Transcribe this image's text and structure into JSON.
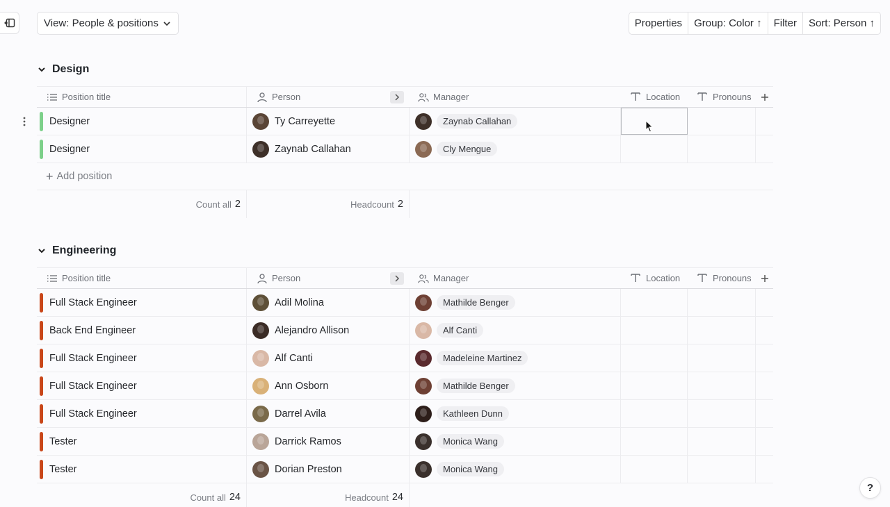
{
  "toolbar": {
    "view_label": "View: People & positions",
    "properties_label": "Properties",
    "group_label": "Group: Color ↑",
    "filter_label": "Filter",
    "sort_label": "Sort: Person ↑"
  },
  "columns": {
    "position": "Position title",
    "person": "Person",
    "manager": "Manager",
    "location": "Location",
    "pronouns": "Pronouns"
  },
  "groups": [
    {
      "name": "Design",
      "color": "#7dd08a",
      "rows": [
        {
          "position": "Designer",
          "person": "Ty Carreyette",
          "person_tone": "#5a4536",
          "manager": "Zaynab Callahan",
          "manager_tone": "#3e3029"
        },
        {
          "position": "Designer",
          "person": "Zaynab Callahan",
          "person_tone": "#3e3029",
          "manager": "Cly Mengue",
          "manager_tone": "#8b6a54"
        }
      ],
      "add_label": "Add position",
      "count_label": "Count all",
      "count_value": "2",
      "headcount_label": "Headcount",
      "headcount_value": "2"
    },
    {
      "name": "Engineering",
      "color": "#c9471a",
      "rows": [
        {
          "position": "Full Stack Engineer",
          "person": "Adil Molina",
          "person_tone": "#5e5038",
          "manager": "Mathilde Benger",
          "manager_tone": "#6e4034"
        },
        {
          "position": "Back End Engineer",
          "person": "Alejandro Allison",
          "person_tone": "#3b2c26",
          "manager": "Alf Canti",
          "manager_tone": "#d9b8a6"
        },
        {
          "position": "Full Stack Engineer",
          "person": "Alf Canti",
          "person_tone": "#d9b8a6",
          "manager": "Madeleine Martinez",
          "manager_tone": "#5a2a2e"
        },
        {
          "position": "Full Stack Engineer",
          "person": "Ann Osborn",
          "person_tone": "#d9b178",
          "manager": "Mathilde Benger",
          "manager_tone": "#6e4034"
        },
        {
          "position": "Full Stack Engineer",
          "person": "Darrel Avila",
          "person_tone": "#7a6a4a",
          "manager": "Kathleen Dunn",
          "manager_tone": "#2d1e1a"
        },
        {
          "position": "Tester",
          "person": "Darrick Ramos",
          "person_tone": "#b9a598",
          "manager": "Monica Wang",
          "manager_tone": "#3a302c"
        },
        {
          "position": "Tester",
          "person": "Dorian Preston",
          "person_tone": "#6a5446",
          "manager": "Monica Wang",
          "manager_tone": "#3a302c"
        }
      ],
      "count_label": "Count all",
      "count_value": "24",
      "headcount_label": "Headcount",
      "headcount_value": "24"
    }
  ],
  "help_label": "?"
}
